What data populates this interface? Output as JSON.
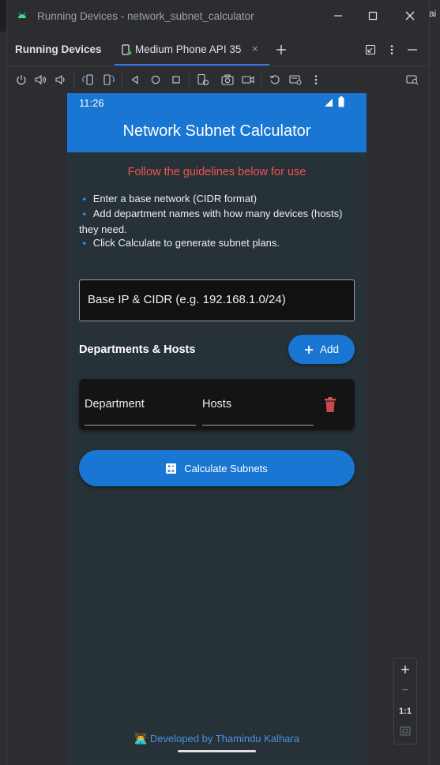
{
  "window": {
    "title": "Running Devices - network_subnet_calculator",
    "background_right_text": "ai"
  },
  "panel": {
    "title": "Running Devices",
    "device_tab_label": "Medium Phone API 35",
    "close_glyph": "×",
    "new_tab_glyph": "+"
  },
  "toolbar": {
    "icons": [
      "power-icon",
      "volume-up-icon",
      "volume-down-icon",
      "rotate-left-icon",
      "rotate-right-icon",
      "back-icon",
      "home-icon",
      "overview-icon",
      "snapshot-icon",
      "screenshot-icon",
      "screen-record-icon",
      "reset-icon",
      "extended-controls-icon",
      "more-icon",
      "device-explorer-icon"
    ]
  },
  "device": {
    "time": "11:26",
    "app_title": "Network Subnet Calculator",
    "guide_heading": "Follow the guidelines below for use",
    "guide_bullet": "🔹",
    "guide_lines": [
      "Enter a base network (CIDR format)",
      "Add department names with how many devices (hosts) they need.",
      "Click Calculate to generate subnet plans."
    ],
    "base_input_placeholder": "Base IP & CIDR (e.g. 192.168.1.0/24)",
    "departments_label": "Departments & Hosts",
    "add_button_label": "Add",
    "department_placeholder": "Department",
    "hosts_placeholder": "Hosts",
    "calculate_button_label": "Calculate Subnets",
    "footer_emoji": "👨‍💻",
    "footer_text": "Developed by Thamindu Kalhara"
  },
  "zoom": {
    "zoom_in": "+",
    "zoom_out": "−",
    "actual_size": "1:1"
  },
  "colors": {
    "primary": "#1976d2",
    "accent_red": "#ef5350",
    "screen_bg": "#263238",
    "ide_bg": "#2b2d30",
    "tab_underline": "#3574f0"
  }
}
